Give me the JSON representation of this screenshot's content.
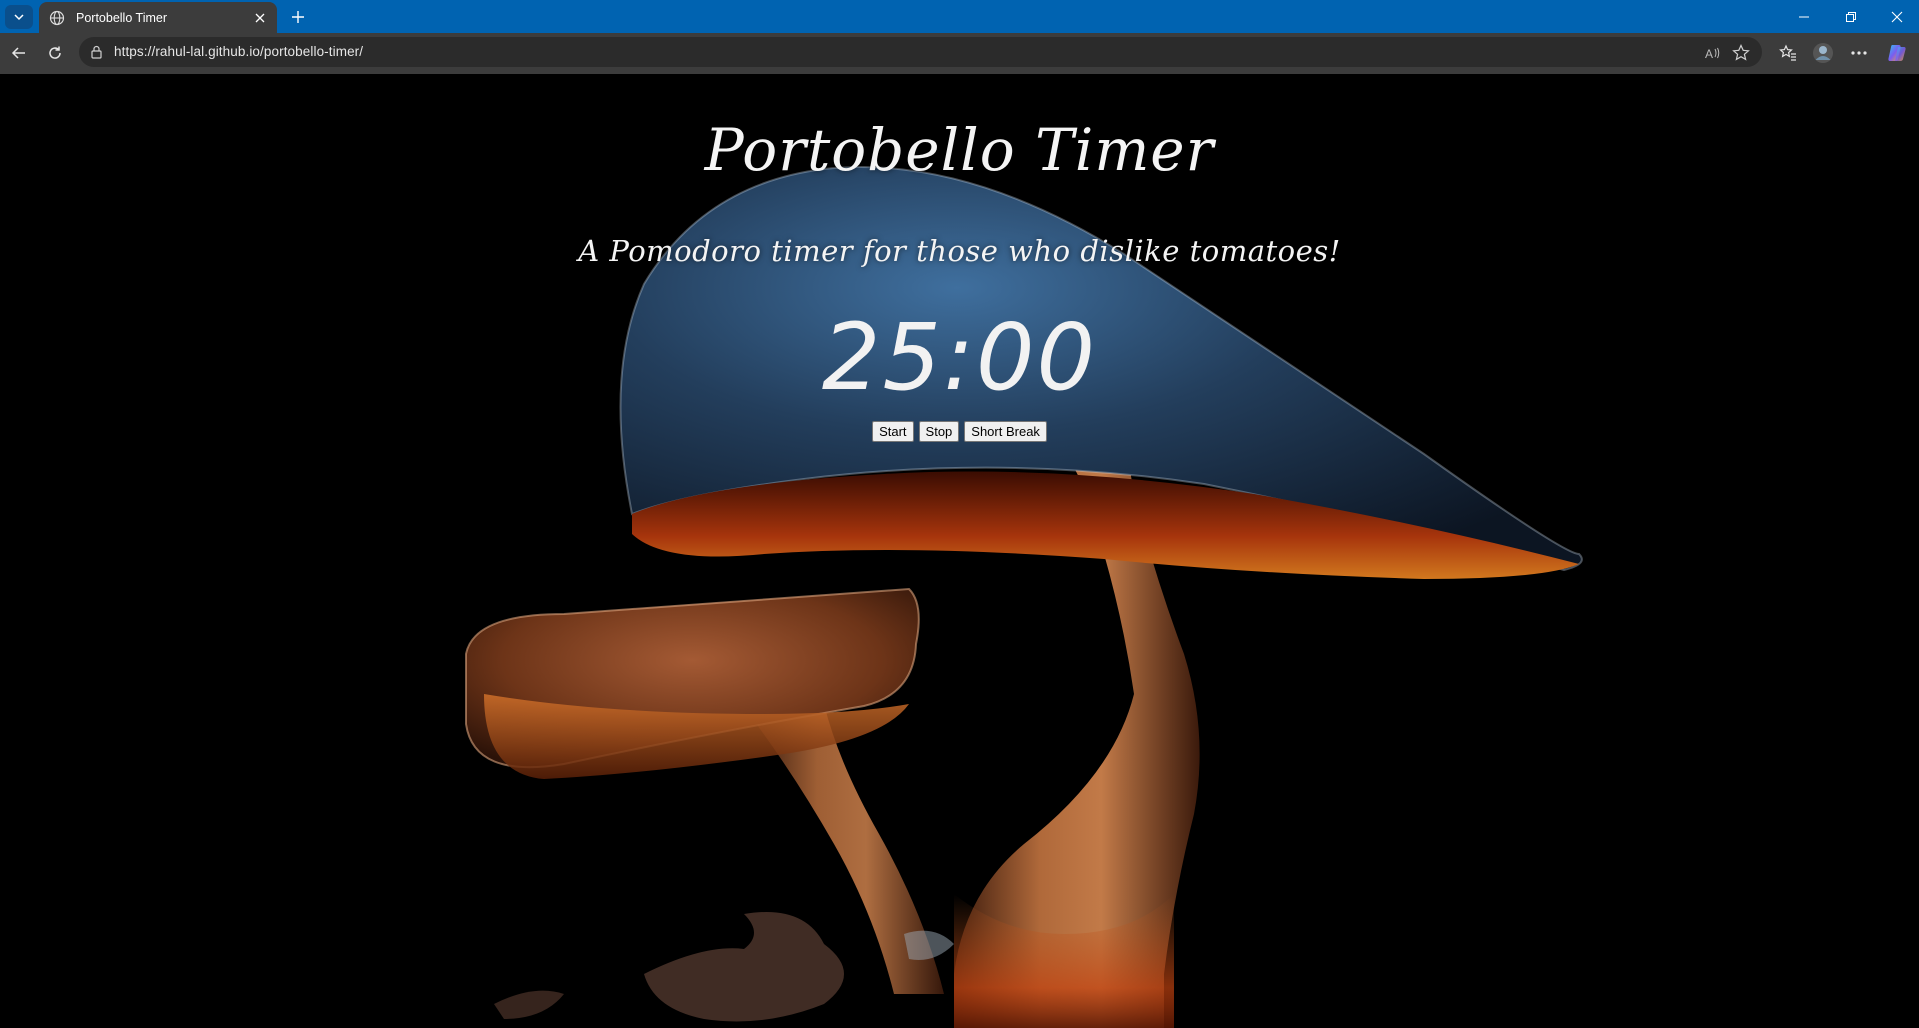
{
  "browser": {
    "tab": {
      "title": "Portobello Timer"
    },
    "address": {
      "url": "https://rahul-lal.github.io/portobello-timer/"
    },
    "colors": {
      "titlebar": "#0063b1",
      "toolbar": "#3c3c3c",
      "addressbar": "#2b2b2b"
    }
  },
  "page": {
    "title": "Portobello Timer",
    "subtitle": "A Pomodoro timer for those who dislike tomatoes!",
    "timer": "25:00",
    "buttons": {
      "start": "Start",
      "stop": "Stop",
      "short_break": "Short Break"
    },
    "background": "mushroom-illustration"
  }
}
